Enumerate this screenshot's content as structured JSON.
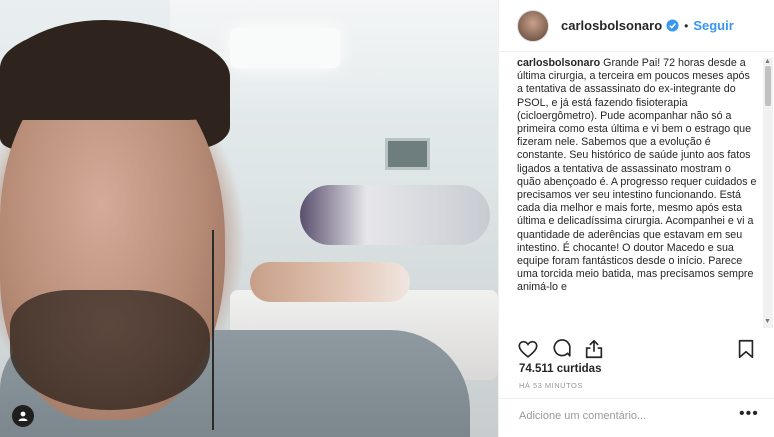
{
  "post": {
    "username": "carlosbolsonaro",
    "follow_label": "Seguir",
    "separator": "•",
    "caption_user": "carlosbolsonaro",
    "caption_text": "Grande Pai! 72 horas desde a última cirurgia, a terceira em poucos meses após a tentativa de assassinato do ex-integrante do PSOL, e já está fazendo fisioterapia (cicloergômetro). Pude acompanhar não só a primeira como esta última e vi bem o estrago que fizeram nele. Sabemos que a evolução é constante. Seu histórico de saúde junto aos fatos ligados a tentativa de assassinato mostram o quão abençoado é. A progresso requer cuidados e precisamos ver seu intestino funcionando. Está cada dia melhor e mais forte, mesmo após esta última e delicadíssima cirurgia. Acompanhei e vi a quantidade de aderências que estavam em seu intestino. É chocante! O doutor Macedo e sua equipe foram fantásticos desde o início. Parece uma torcida meio batida, mas precisamos sempre animá-lo e",
    "likes": "74.511 curtidas",
    "time": "HÁ 53 MINUTOS",
    "comment_placeholder": "Adicione um comentário...",
    "more_label": "•••"
  },
  "icons": {
    "verified": "verified-badge-icon",
    "like": "heart-icon",
    "comment": "comment-icon",
    "share": "share-icon",
    "save": "bookmark-icon",
    "user": "user-icon"
  },
  "colors": {
    "link": "#3897f0",
    "verified": "#3897f0",
    "muted": "#999999",
    "text": "#262626"
  }
}
